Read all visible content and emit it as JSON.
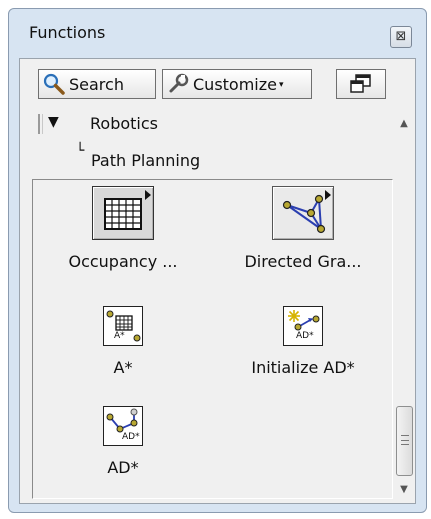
{
  "window": {
    "title": "Functions",
    "close_glyph": "⊠"
  },
  "toolbar": {
    "search_label": "Search",
    "customize_label": "Customize",
    "customize_caret": "▾"
  },
  "tree": {
    "expand_glyph": "▼",
    "category": "Robotics",
    "sub_prefix": "└",
    "subcategory": "Path Planning"
  },
  "palette": {
    "items": [
      {
        "label": "Occupancy ...",
        "icon": "occupancy-grid-icon"
      },
      {
        "label": "Directed Gra...",
        "icon": "directed-graph-icon"
      },
      {
        "label": "A*",
        "icon": "a-star-icon"
      },
      {
        "label": "Initialize AD*",
        "icon": "initialize-ad-star-icon"
      },
      {
        "label": "AD*",
        "icon": "ad-star-icon"
      }
    ],
    "a_star_icon_text": "A*",
    "ad_star_icon_text": "AD*"
  },
  "scrollbar": {
    "up_glyph": "▲",
    "down_glyph": "▼"
  },
  "colors": {
    "frame": "#d7e4f2",
    "client": "#f0f0f0",
    "node": "#b8a832",
    "edge": "#2b3fb0"
  }
}
